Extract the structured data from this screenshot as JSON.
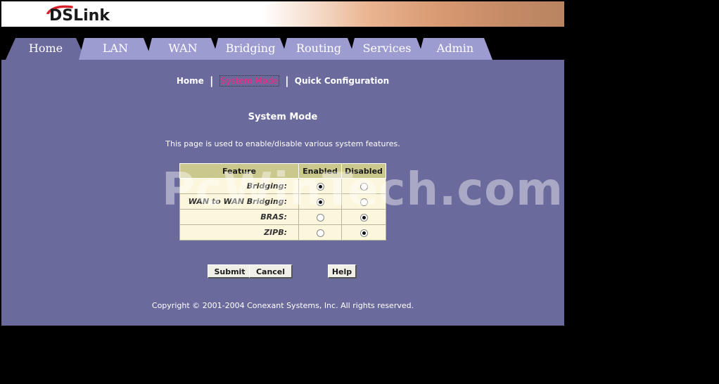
{
  "brand": {
    "logo_text": "DSLink"
  },
  "tabs": [
    {
      "label": "Home"
    },
    {
      "label": "LAN"
    },
    {
      "label": "WAN"
    },
    {
      "label": "Bridging"
    },
    {
      "label": "Routing"
    },
    {
      "label": "Services"
    },
    {
      "label": "Admin"
    }
  ],
  "subnav": {
    "items": [
      "Home",
      "System Mode",
      "Quick Configuration"
    ],
    "separator": "|"
  },
  "page": {
    "title": "System Mode",
    "description": "This page is used to enable/disable various system features."
  },
  "table": {
    "headers": [
      "Feature",
      "Enabled",
      "Disabled"
    ],
    "rows": [
      {
        "feature": "Bridging:",
        "enabled": true
      },
      {
        "feature": "WAN to WAN Bridging:",
        "enabled": true
      },
      {
        "feature": "BRAS:",
        "enabled": false
      },
      {
        "feature": "ZIPB:",
        "enabled": false
      }
    ]
  },
  "buttons": {
    "submit": "Submit",
    "cancel": "Cancel",
    "help": "Help"
  },
  "footer": {
    "copyright": "Copyright © 2001-2004 Conexant Systems, Inc. All rights reserved."
  },
  "watermark": "PcWinTech.com",
  "colors": {
    "content_bg": "#6b6a9c",
    "tab_active": "#6b6a9c",
    "tab_inactive": "#9d9cd0",
    "active_link": "#ff1f7a",
    "table_header": "#cbc88e",
    "table_body": "#fcf7dc"
  }
}
